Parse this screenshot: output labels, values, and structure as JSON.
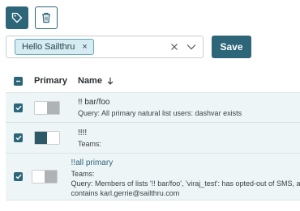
{
  "toolbar": {
    "tag_icon": "tag-icon",
    "trash_icon": "trash-icon"
  },
  "filter": {
    "chip_label": "Hello Sailthru",
    "chip_remove": "×",
    "clear_icon": "close-icon",
    "dropdown_icon": "chevron-down-icon",
    "save_label": "Save"
  },
  "table": {
    "headers": {
      "primary": "Primary",
      "name": "Name"
    },
    "sort_icon": "arrow-down-icon",
    "rows": [
      {
        "name": "!! bar/foo",
        "primary": "partial",
        "lines": [
          "Query: All primary natural list users: dashvar exists"
        ]
      },
      {
        "name": "!!!!",
        "primary": "on",
        "lines": [
          "Teams:"
        ]
      },
      {
        "name": "!!all primary",
        "primary": "partial",
        "lines": [
          "Teams:",
          "Query: Members of lists '!! bar/foo', 'viraj_test': has opted-out of SMS, and email",
          "contains karl.gerrie@sailthru.com"
        ]
      }
    ]
  },
  "colors": {
    "brand": "#2c6678",
    "row_bg": "#eef5f7",
    "chip_bg": "#d7ecf2"
  }
}
